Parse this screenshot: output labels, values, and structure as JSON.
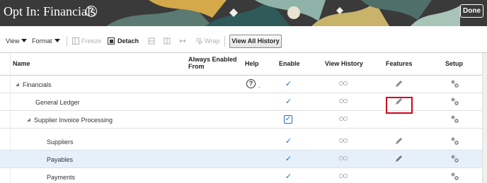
{
  "header": {
    "title": "Opt In: Financials",
    "help_icon": "question-circle-icon",
    "done_label": "Done"
  },
  "toolbar": {
    "view_label": "View",
    "format_label": "Format",
    "freeze_label": "Freeze",
    "detach_label": "Detach",
    "wrap_label": "Wrap",
    "view_all_history_label": "View All History"
  },
  "table": {
    "columns": {
      "name": "Name",
      "always_enabled_from_line1": "Always Enabled",
      "always_enabled_from_line2": "From",
      "help": "Help",
      "enable": "Enable",
      "view_history": "View History",
      "features": "Features",
      "setup": "Setup"
    },
    "rows": [
      {
        "name": "Financials",
        "level": 0,
        "expanded": true,
        "help": true,
        "help_dot": ".",
        "enable": "check",
        "features": true,
        "selected": false
      },
      {
        "name": "General Ledger",
        "level": 1,
        "expanded": false,
        "help": false,
        "enable": "check",
        "features": true,
        "selected": false
      },
      {
        "name": "Supplier Invoice Processing",
        "level": 1,
        "expanded": true,
        "help": false,
        "enable": "checkbox",
        "features": false,
        "selected": false
      },
      {
        "name": "Suppliers",
        "level": 2,
        "expanded": false,
        "help": false,
        "enable": "check",
        "features": true,
        "selected": false
      },
      {
        "name": "Payables",
        "level": 2,
        "expanded": false,
        "help": false,
        "enable": "check",
        "features": true,
        "selected": true
      },
      {
        "name": "Payments",
        "level": 2,
        "expanded": false,
        "help": false,
        "enable": "check",
        "features": false,
        "selected": false
      }
    ]
  },
  "colors": {
    "header_bg": "#3a3a3a",
    "check": "#1f6fc5",
    "selected_row": "#e6f0fb",
    "highlight": "#d0021b"
  }
}
